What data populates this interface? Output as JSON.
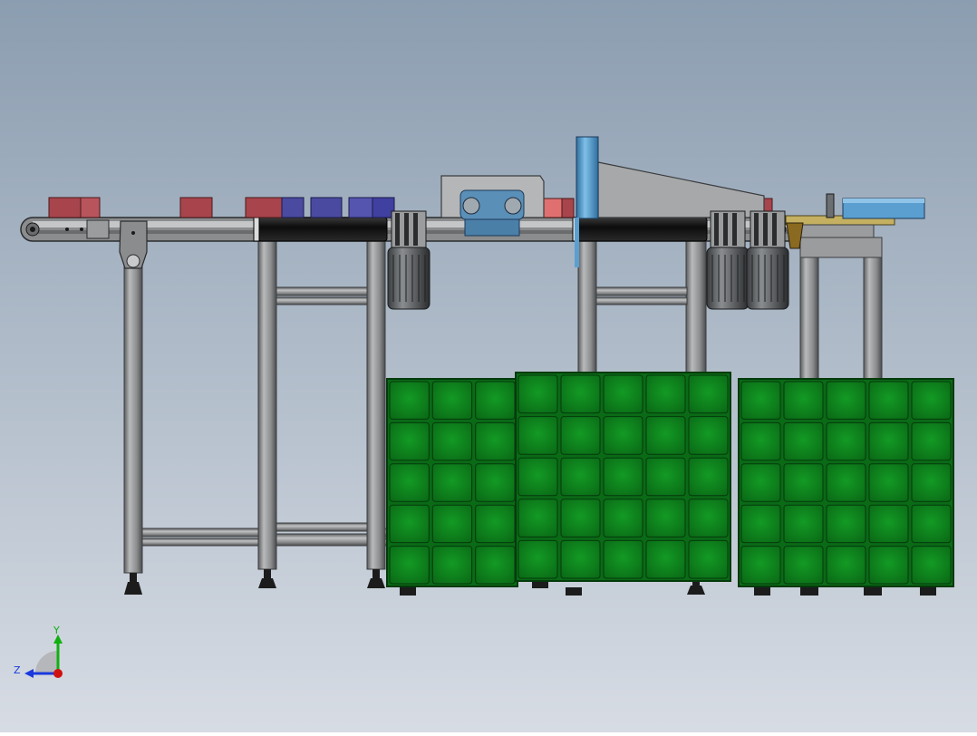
{
  "scene": {
    "background_top": "#8b9db0",
    "background_bottom": "#d7dce4",
    "frame_color": "#8a8c8e",
    "frame_edge": "#3c3e40",
    "crate_green": "#0f7a1c",
    "crate_edge": "#053a0c",
    "box_red": "#a8444c",
    "box_salmon": "#e07070",
    "box_blue": "#4a4aa0",
    "motor_color": "#6c6f72",
    "roller_color": "#1a1a1a",
    "accent_blue": "#5a9fd0"
  },
  "axis_triad": {
    "y_label": "Y",
    "z_label": "Z",
    "y_color": "#10b010",
    "z_color": "#1a3adc",
    "x_color": "#d01010"
  }
}
